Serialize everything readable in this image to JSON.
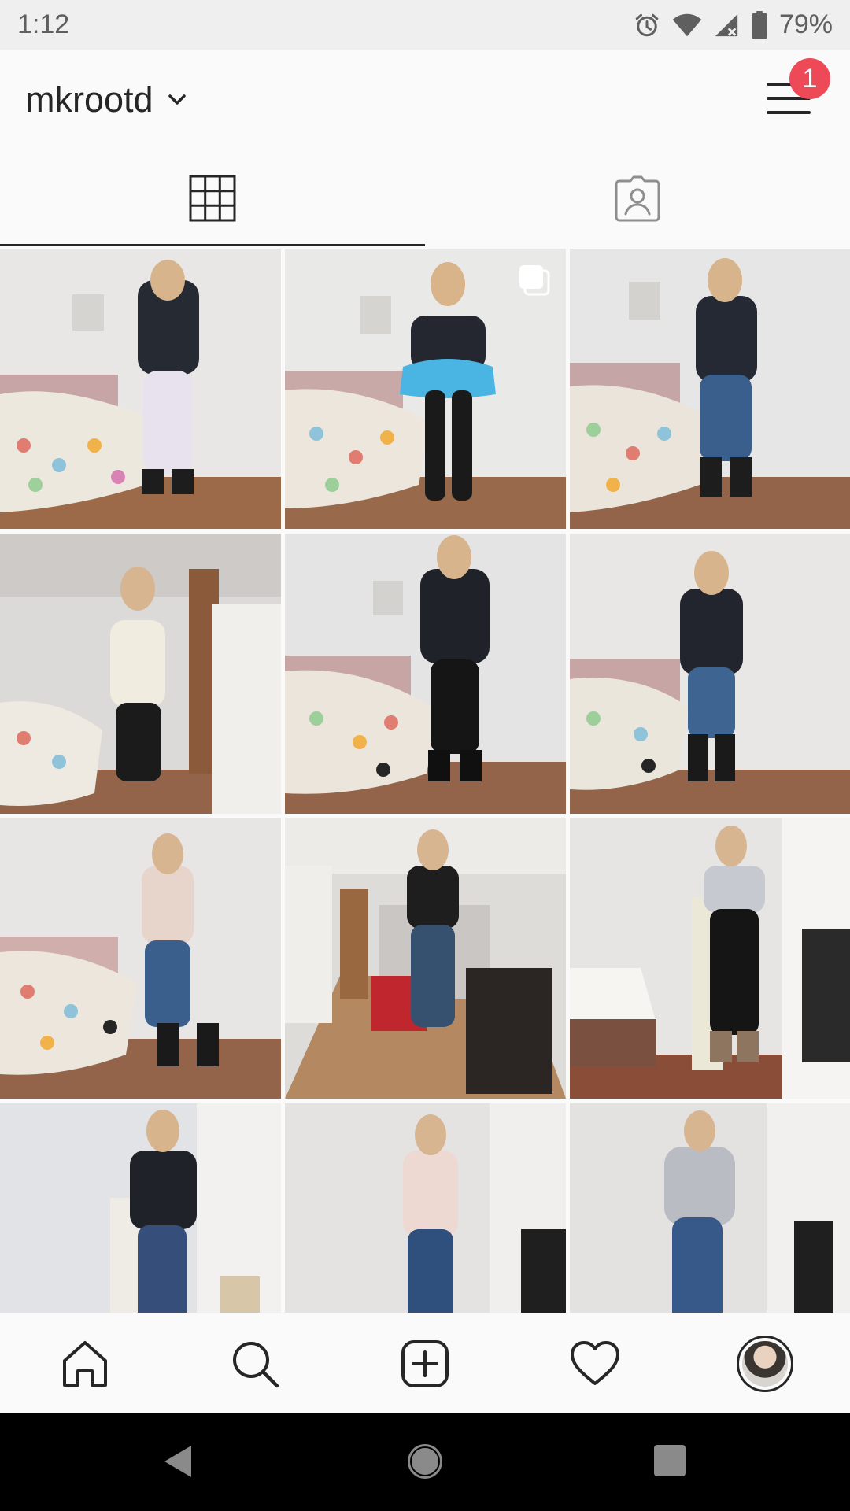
{
  "status_bar": {
    "time": "1:12",
    "battery": "79%",
    "icons": [
      "alarm-icon",
      "wifi-icon",
      "cell-signal-icon",
      "battery-icon"
    ]
  },
  "header": {
    "username": "mkrootd",
    "notification_count": "1",
    "icons": [
      "chevron-down-icon",
      "menu-icon"
    ]
  },
  "tabs": [
    {
      "name": "grid-tab",
      "icon": "grid-icon",
      "selected": true
    },
    {
      "name": "tagged-tab",
      "icon": "tagged-person-icon",
      "selected": false
    }
  ],
  "grid": {
    "tiles": [
      {
        "name": "post-1",
        "multi": false
      },
      {
        "name": "post-2",
        "multi": true
      },
      {
        "name": "post-3",
        "multi": false
      },
      {
        "name": "post-4",
        "multi": false
      },
      {
        "name": "post-5",
        "multi": false
      },
      {
        "name": "post-6",
        "multi": false
      },
      {
        "name": "post-7",
        "multi": false
      },
      {
        "name": "post-8",
        "multi": false
      },
      {
        "name": "post-9",
        "multi": false
      },
      {
        "name": "post-10",
        "multi": false
      },
      {
        "name": "post-11",
        "multi": false
      },
      {
        "name": "post-12",
        "multi": false
      }
    ]
  },
  "bottom_nav": {
    "items": [
      "home-icon",
      "search-icon",
      "new-post-icon",
      "activity-heart-icon",
      "profile-avatar"
    ]
  },
  "system_nav": {
    "items": [
      "back-icon",
      "home-circle-icon",
      "recents-icon"
    ]
  },
  "colors": {
    "accent_badge": "#ed4956",
    "text": "#262626",
    "background": "#fafafa"
  }
}
